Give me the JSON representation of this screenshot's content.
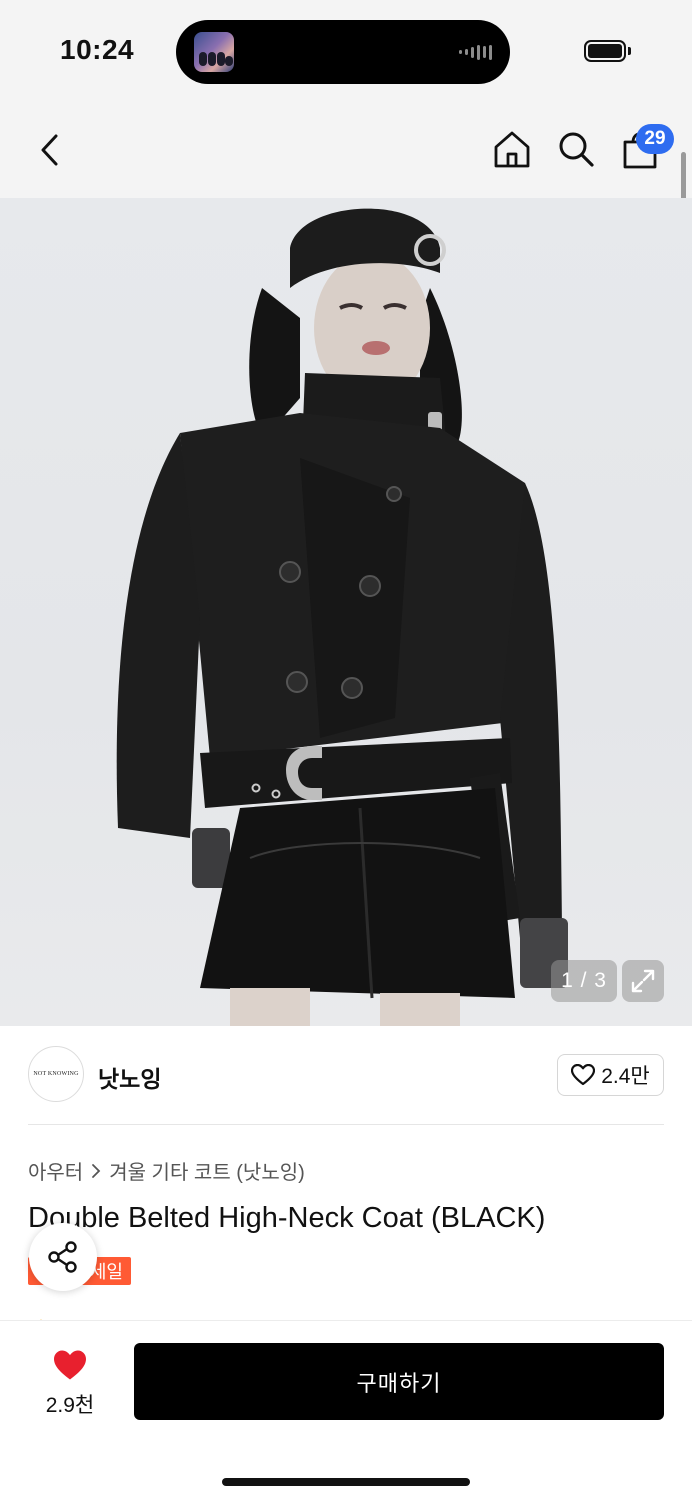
{
  "status_bar": {
    "time": "10:24"
  },
  "header": {
    "cart_count": "29",
    "icons": [
      "chevron-left-icon",
      "home-icon",
      "search-icon",
      "shopping-bag-icon"
    ]
  },
  "gallery": {
    "counter": "1 / 3"
  },
  "brand": {
    "logo_text": "NOT KNOWING",
    "name": "낫노잉",
    "likes": "2.4만"
  },
  "product": {
    "breadcrumb": [
      "아우터",
      "겨울 기타 코트 (낫노잉)"
    ],
    "title": "Double Belted High-Neck Coat (BLACK)",
    "badge": "세일"
  },
  "bottom_bar": {
    "favorite_count": "2.9천",
    "buy_label": "구매하기"
  },
  "colors": {
    "accent_blue": "#2e6cf0",
    "sale_orange": "#ff5a34",
    "heart_red": "#e8202e",
    "buy_black": "#000000"
  }
}
